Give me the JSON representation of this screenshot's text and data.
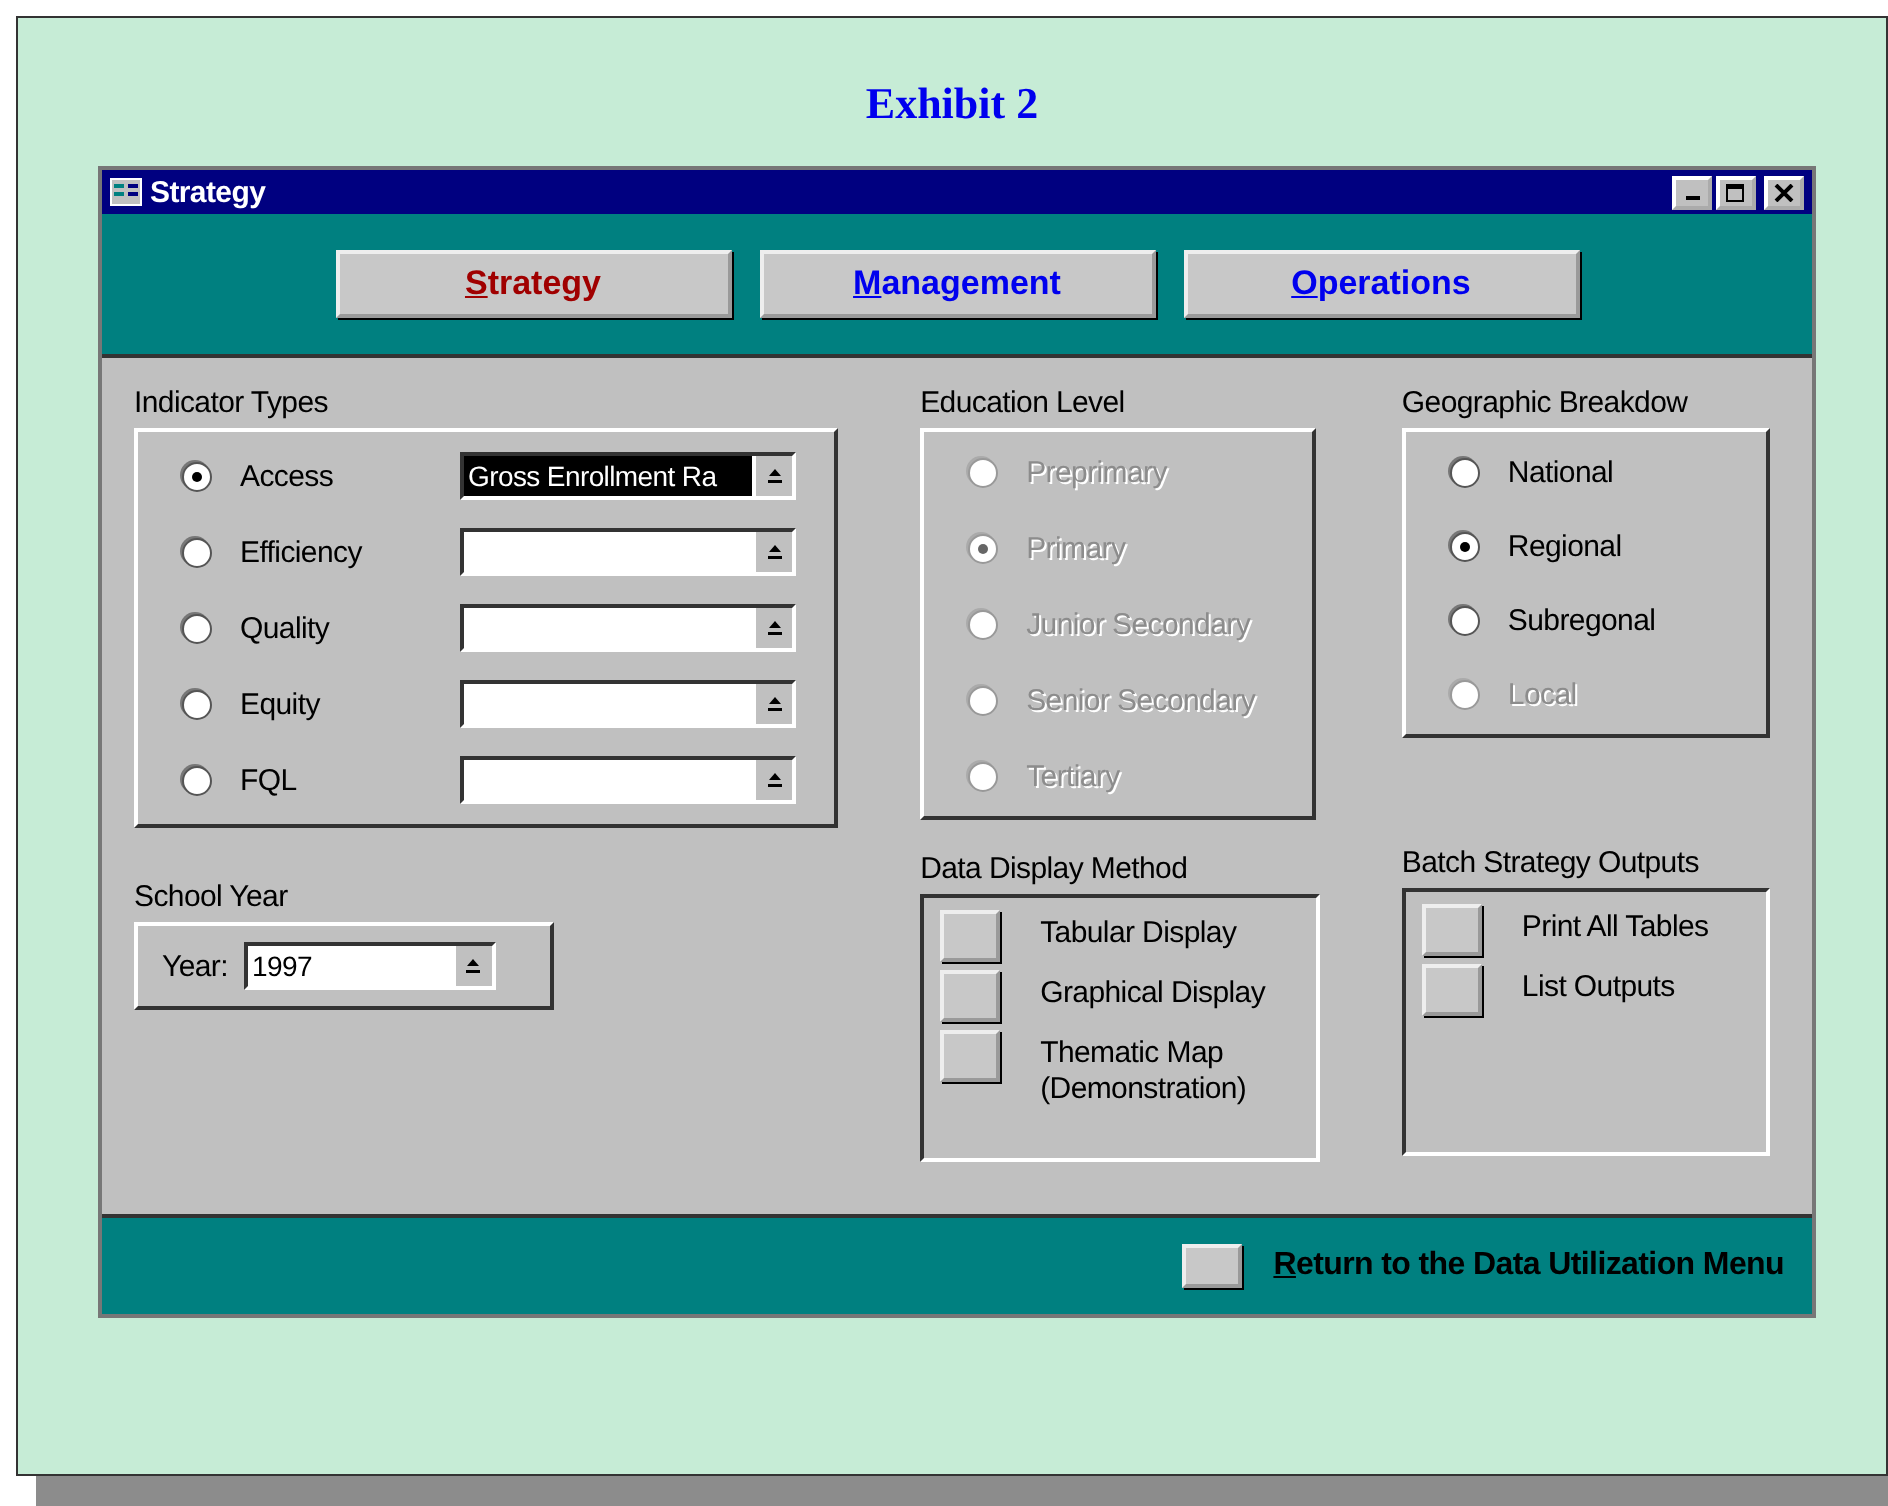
{
  "exhibit_title": "Exhibit 2",
  "window": {
    "title": "Strategy"
  },
  "nav_buttons": [
    {
      "label": "Strategy",
      "selected": true,
      "mnemonic": true
    },
    {
      "label": "Management",
      "selected": false,
      "mnemonic": true
    },
    {
      "label": "Operations",
      "selected": false,
      "mnemonic": true
    }
  ],
  "indicator_types": {
    "title": "Indicator Types",
    "items": [
      {
        "label": "Access",
        "selected": true,
        "value": "Gross Enrollment Ra"
      },
      {
        "label": "Efficiency",
        "selected": false
      },
      {
        "label": "Quality",
        "selected": false
      },
      {
        "label": "Equity",
        "selected": false
      },
      {
        "label": "FQL",
        "selected": false
      }
    ]
  },
  "school_year": {
    "title": "School Year",
    "label": "Year:",
    "value": "1997"
  },
  "education_level": {
    "title": "Education Level",
    "items": [
      {
        "label": "Preprimary",
        "selected": false,
        "disabled": true
      },
      {
        "label": "Primary",
        "selected": true,
        "disabled": true
      },
      {
        "label": "Junior Secondary",
        "selected": false,
        "disabled": true
      },
      {
        "label": "Senior Secondary",
        "selected": false,
        "disabled": true
      },
      {
        "label": "Tertiary",
        "selected": false,
        "disabled": true
      }
    ]
  },
  "geographic_breakdown": {
    "title": "Geographic Breakdow",
    "items": [
      {
        "label": "National",
        "selected": false,
        "disabled": false
      },
      {
        "label": "Regional",
        "selected": true,
        "disabled": false
      },
      {
        "label": "Subregonal",
        "selected": false,
        "disabled": false
      },
      {
        "label": "Local",
        "selected": false,
        "disabled": true
      }
    ]
  },
  "data_display_method": {
    "title": "Data Display Method",
    "buttons": [
      "Tabular Display",
      "Graphical Display",
      "Thematic Map\n(Demonstration)"
    ]
  },
  "batch_strategy_outputs": {
    "title": "Batch Strategy Outputs",
    "buttons": [
      "Print All Tables",
      "List Outputs"
    ]
  },
  "footer": {
    "button": {
      "label": "Return to the Data Utilization Menu",
      "mnemonic": true
    }
  }
}
